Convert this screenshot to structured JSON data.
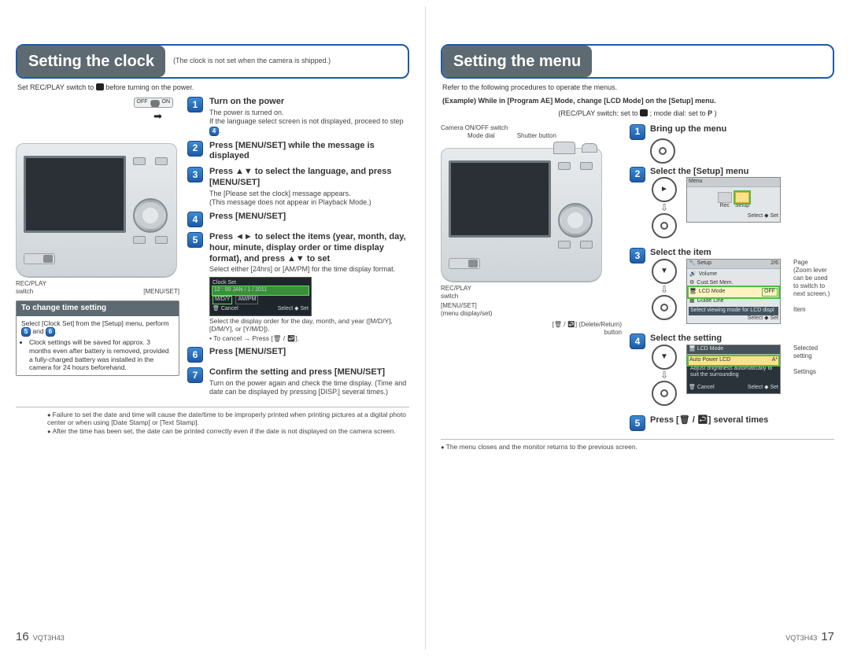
{
  "left": {
    "title": "Setting the clock",
    "title_note": "(The clock is not set when the camera is shipped.)",
    "intro": "Set REC/PLAY switch to ◉ before turning on the power.",
    "switch_off": "OFF",
    "switch_on": "ON",
    "labels": {
      "recplay": "REC/PLAY\nswitch",
      "menuset": "[MENU/SET]"
    },
    "steps": [
      {
        "n": "1",
        "t": "Turn on the power",
        "d": "The power is turned on.\nIf the language select screen is not displayed, proceed to step 4."
      },
      {
        "n": "2",
        "t": "Press [MENU/SET] while the message is displayed",
        "d": ""
      },
      {
        "n": "3",
        "t": "Press ▲▼ to select the language, and press [MENU/SET]",
        "d": "The [Please set the clock] message appears.\n(This message does not appear in Playback Mode.)"
      },
      {
        "n": "4",
        "t": "Press [MENU/SET]",
        "d": ""
      },
      {
        "n": "5",
        "t": "Press ◄► to select the items (year, month, day, hour, minute, display order or time display format), and press ▲▼ to set",
        "d": "Select either [24hrs] or [AM/PM] for the time display format."
      },
      {
        "n": "6",
        "t": "Press [MENU/SET]",
        "d": ""
      },
      {
        "n": "7",
        "t": "Confirm the setting and press [MENU/SET]",
        "d": "Turn on the power again and check the time display. (Time and date can be displayed by pressing [DISP.] several times.)"
      }
    ],
    "clock_sample": {
      "title": "Clock Set",
      "line": "12 : 00   JAN / 1 / 2011",
      "order": "M/D/Y",
      "fmt": "AM/PM",
      "cancel": "Cancel",
      "sel": "Select ◆ Set"
    },
    "below5": "Select the display order for the day, month, and year ([M/D/Y], [D/M/Y], or [Y/M/D]).",
    "below5b": "• To cancel → Press [🗑 / ↩].",
    "tip": {
      "h": "To change time setting",
      "b1": "Select [Clock Set] from the [Setup] menu, perform 5 and 6.",
      "b2": "Clock settings will be saved for approx. 3 months even after battery is removed, provided a fully-charged battery was installed in the camera for 24 hours beforehand."
    },
    "notes": [
      "Failure to set the date and time will cause the date/time to be improperly printed when printing pictures at a digital photo center or when using [Date Stamp] or [Text Stamp].",
      "After the time has been set, the date can be printed correctly even if the date is not displayed on the camera screen."
    ],
    "pagefoot": "VQT3H43",
    "pagenum": "16"
  },
  "right": {
    "title": "Setting the menu",
    "intro": "Refer to the following procedures to operate the menus.",
    "example": "(Example) While in [Program AE] Mode, change [LCD Mode] on the [Setup] menu.",
    "sub": "(REC/PLAY switch: set to ◉ ; mode dial: set to P )",
    "diagram": {
      "camonoff": "Camera ON/OFF switch",
      "modedial": "Mode dial",
      "shutter": "Shutter button",
      "recplay": "REC/PLAY\nswitch",
      "menuset": "[MENU/SET]\n(menu display/set)",
      "delret": "[🗑 / ↩] (Delete/Return)\nbutton"
    },
    "steps": [
      {
        "n": "1",
        "t": "Bring up the menu"
      },
      {
        "n": "2",
        "t": "Select the [Setup] menu"
      },
      {
        "n": "3",
        "t": "Select the item"
      },
      {
        "n": "4",
        "t": "Select the setting"
      },
      {
        "n": "5",
        "t": "Press [🗑 / ↩] several times"
      }
    ],
    "sc2": {
      "menu": "Menu",
      "rec": "Rec",
      "setup": "Setup",
      "sel": "Select ◆   Set"
    },
    "sc3": {
      "title": "Setup",
      "items": [
        "Volume",
        "Cust.Set Mem.",
        "LCD Mode",
        "Guide Line"
      ],
      "val": "OFF",
      "bar": "Select viewing mode for LCD displ",
      "pg": "2/6",
      "sel": "Select ◆   Set"
    },
    "sc4": {
      "title": "LCD Mode",
      "opt": "Auto Power LCD",
      "desc": "Adjust brightness automatically to suit the surrounding",
      "cancel": "Cancel",
      "sel": "Select ◆   Set"
    },
    "ann3": {
      "page": "Page\n(Zoom lever can be used to switch to next screen.)",
      "item": "Item"
    },
    "ann4": {
      "seld": "Selected setting",
      "set": "Settings"
    },
    "closing": "The menu closes and the monitor returns to the previous screen.",
    "pagefoot": "VQT3H43",
    "pagenum": "17"
  }
}
